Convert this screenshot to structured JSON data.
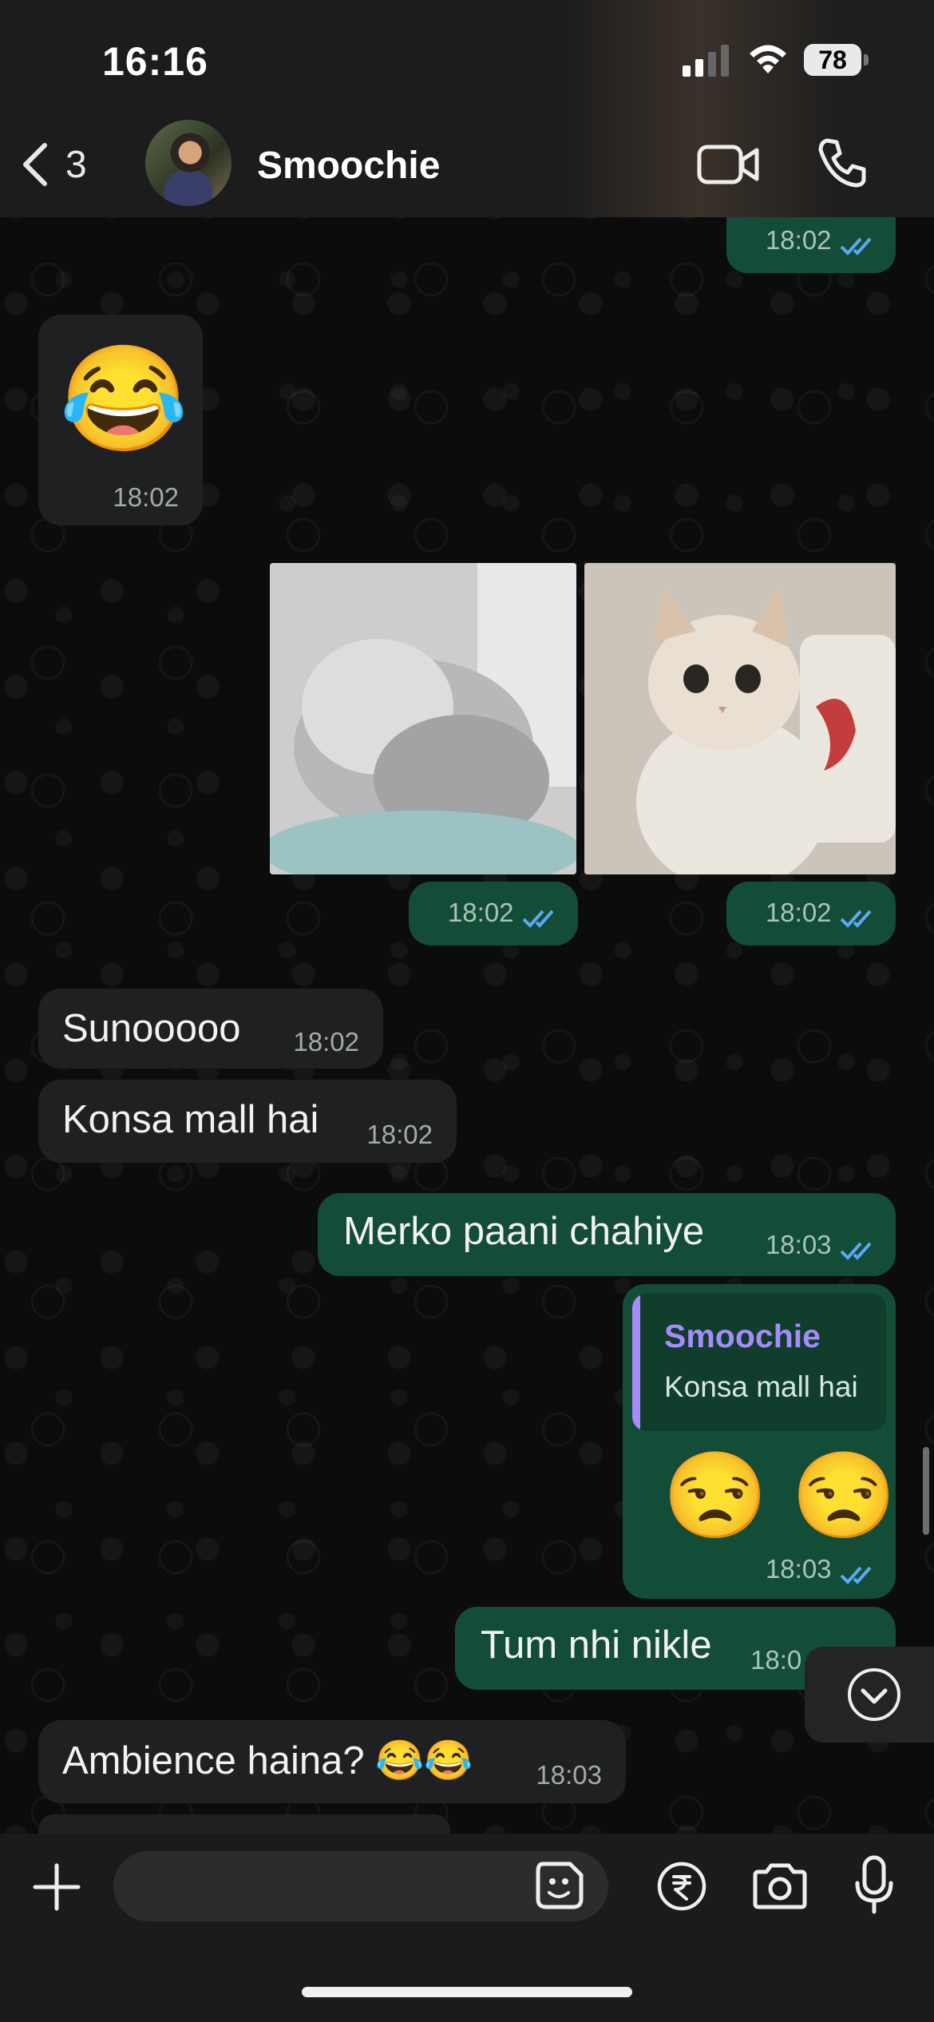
{
  "status_bar": {
    "time": "16:16",
    "battery": "78"
  },
  "header": {
    "back_count": "3",
    "contact_name": "Smoochie"
  },
  "messages": [
    {
      "id": "m0",
      "direction": "out",
      "text": "",
      "time": "18:02",
      "read": true
    },
    {
      "id": "m1",
      "direction": "in",
      "emoji": "😂",
      "time": "18:02"
    },
    {
      "id": "m2",
      "direction": "out",
      "type": "image",
      "time": "18:02",
      "read": true
    },
    {
      "id": "m3",
      "direction": "out",
      "type": "image",
      "time": "18:02",
      "read": true
    },
    {
      "id": "m4",
      "direction": "in",
      "text": "Sunooooo",
      "time": "18:02"
    },
    {
      "id": "m5",
      "direction": "in",
      "text": "Konsa mall hai",
      "time": "18:02"
    },
    {
      "id": "m6",
      "direction": "out",
      "text": "Merko paani chahiye",
      "time": "18:03",
      "read": true
    },
    {
      "id": "m7",
      "direction": "out",
      "reply_to": {
        "author": "Smoochie",
        "text": "Konsa mall hai"
      },
      "emoji": "😒 😒",
      "time": "18:03",
      "read": true
    },
    {
      "id": "m8",
      "direction": "out",
      "text": "Tum nhi nikle",
      "time": "18:0",
      "read": true
    },
    {
      "id": "m9",
      "direction": "in",
      "text": "Ambience haina? 😂😂",
      "time": "18:03"
    }
  ],
  "composer": {
    "placeholder": ""
  },
  "colors": {
    "outgoing": "#134d37",
    "incoming": "#1f2021",
    "read_tick": "#5aa9f5",
    "reply_author": "#a78bfa"
  },
  "icons": [
    "back-chevron-icon",
    "video-call-icon",
    "phone-icon",
    "double-check-icon",
    "chevron-down-icon",
    "plus-icon",
    "sticker-icon",
    "rupee-icon",
    "camera-icon",
    "mic-icon"
  ]
}
